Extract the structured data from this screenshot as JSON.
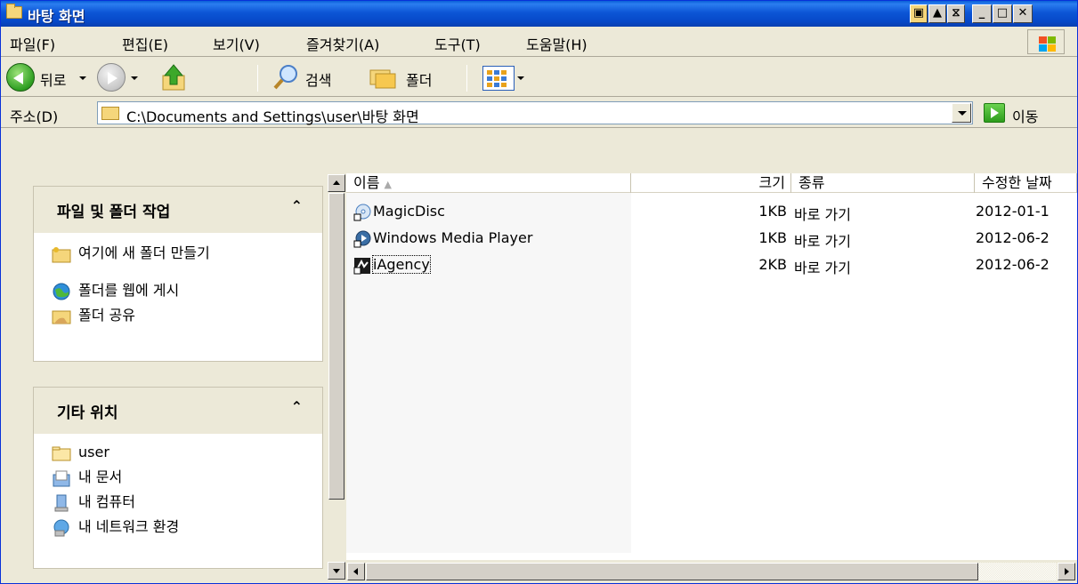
{
  "window": {
    "title": "바탕 화면"
  },
  "menu": [
    "파일(F)",
    "편집(E)",
    "보기(V)",
    "즐겨찾기(A)",
    "도구(T)",
    "도움말(H)"
  ],
  "toolbar": {
    "back_label": "뒤로",
    "search_label": "검색",
    "folders_label": "폴더"
  },
  "address": {
    "label": "주소(D)",
    "value": "C:\\Documents and Settings\\user\\바탕 화면",
    "go_label": "이동"
  },
  "tasks": {
    "file_folder": {
      "header": "파일 및 폴더 작업",
      "items": [
        "여기에 새 폴더 만들기",
        "폴더를 웹에 게시",
        "폴더 공유"
      ]
    },
    "other_places": {
      "header": "기타 위치",
      "items": [
        "user",
        "내 문서",
        "내 컴퓨터",
        "내 네트워크 환경"
      ]
    }
  },
  "list": {
    "columns": [
      "이름",
      "크기",
      "종류",
      "수정한 날짜"
    ],
    "rows": [
      {
        "name": "MagicDisc",
        "size": "1KB",
        "type": "바로 가기",
        "date": "2012-01-1"
      },
      {
        "name": "Windows Media Player",
        "size": "1KB",
        "type": "바로 가기",
        "date": "2012-06-2"
      },
      {
        "name": "iAgency",
        "size": "2KB",
        "type": "바로 가기",
        "date": "2012-06-2"
      }
    ]
  },
  "colors": {
    "titlebar": "#0a5fd8",
    "window_bg": "#ece9d8",
    "border": "#0831d9"
  }
}
